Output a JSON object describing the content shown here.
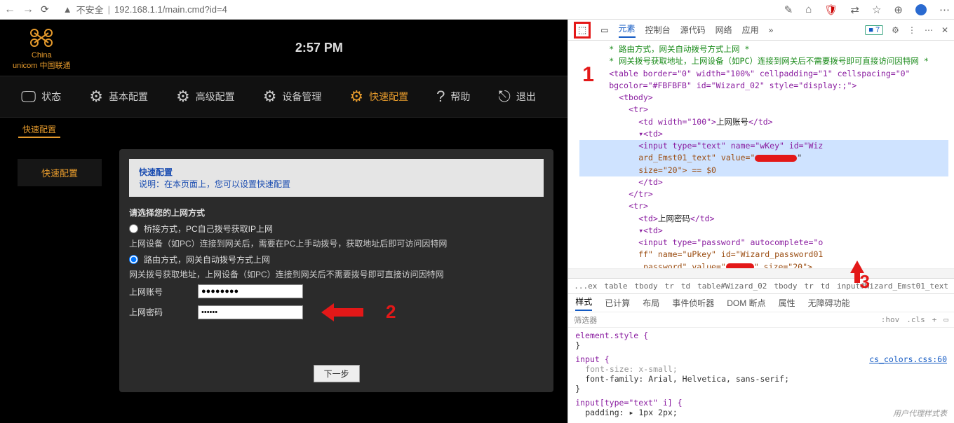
{
  "browser": {
    "insecure_label": "不安全",
    "url": "192.168.1.1/main.cmd?id=4"
  },
  "router": {
    "logo_top": "China",
    "logo_bottom": "unicom 中国联通",
    "time": "2:57 PM",
    "nav": {
      "status": "状态",
      "basic": "基本配置",
      "advanced": "高级配置",
      "device": "设备管理",
      "quick": "快速配置",
      "help": "帮助",
      "logout": "退出"
    },
    "crumb": "快速配置",
    "side_item": "快速配置",
    "hint_title": "快速配置",
    "hint_prefix": "说明：",
    "hint_body": "在本页面上，您可以设置快速配置",
    "section_title": "请选择您的上网方式",
    "opt1": "桥接方式，PC自己拨号获取IP上网",
    "opt1_desc": "上网设备（如PC）连接到网关后，需要在PC上手动拨号，获取地址后即可访问因特网",
    "opt2": "路由方式，网关自动拨号方式上网",
    "opt2_desc": "网关拨号获取地址，上网设备（如PC）连接到网关后不需要拨号即可直接访问因特网",
    "label_user": "上网账号",
    "label_pass": "上网密码",
    "value_user": "●●●●●●●●",
    "value_pass": "●●●●●●",
    "next": "下一步"
  },
  "annotations": {
    "a1": "1",
    "a2": "2",
    "a3": "3"
  },
  "devtools": {
    "tabs": {
      "elements": "元素",
      "console": "控制台",
      "sources": "源代码",
      "network": "网络",
      "app": "应用"
    },
    "more": "»",
    "issues": "■ 7",
    "dom": {
      "cm1": "* 路由方式，网关自动拨号方式上网 *",
      "cm2": "* 网关拨号获取地址，上网设备（如PC）连接到网关后不需要拨号即可直接访问因特网 *",
      "table": "<table border=\"0\" width=\"100%\" cellpadding=\"1\" cellspacing=\"0\" bgcolor=\"#FBFBFB\" id=\"Wizard_02\" style=\"display:;\">",
      "tbody": "<tbody>",
      "tro": "<tr>",
      "td_user": "<td width=\"100\">",
      "td_user_text": "上网账号",
      "tdc": "</td>",
      "td2": "▾<td>",
      "input_user_a": "<input type=\"text\" name=\"wKey\" id=\"Wiz",
      "input_user_b": "ard_Emst01_text\" value=\"",
      "input_user_c": "size=\"20\"> == $0",
      "tdcc": "</td>",
      "trc": "</tr>",
      "td_pass_text": "上网密码",
      "input_pass_a": "<input type=\"password\" autocomplete=\"o",
      "input_pass_b": "ff\" name=\"uPkey\" id=\"Wizard_password01",
      "input_pass_c": "_password\" value=\"",
      "input_pass_d": "\" size=\"20\">"
    },
    "crumbs": [
      "...ex",
      "table",
      "tbody",
      "tr",
      "td",
      "table#Wizard_02",
      "tbody",
      "tr",
      "td",
      "input#Wizard_Emst01_text"
    ],
    "styles_tabs": {
      "styles": "样式",
      "computed": "已计算",
      "layout": "布局",
      "listeners": "事件侦听器",
      "dom": "DOM 断点",
      "props": "属性",
      "a11y": "无障碍功能"
    },
    "filter": "筛选器",
    "hov": ":hov",
    "cls": ".cls",
    "rule1": "element.style {",
    "rule1c": "}",
    "rule2": "input {",
    "rule2_p1": "font-size: x-small;",
    "rule2_p2": "font-family: Arial, Helvetica, sans-serif;",
    "rule2_link": "cs_colors.css:60",
    "rule3": "input[type=\"text\" i] {",
    "rule3_p1": "padding: ▸ 1px 2px;",
    "ua": "用户代理样式表"
  }
}
